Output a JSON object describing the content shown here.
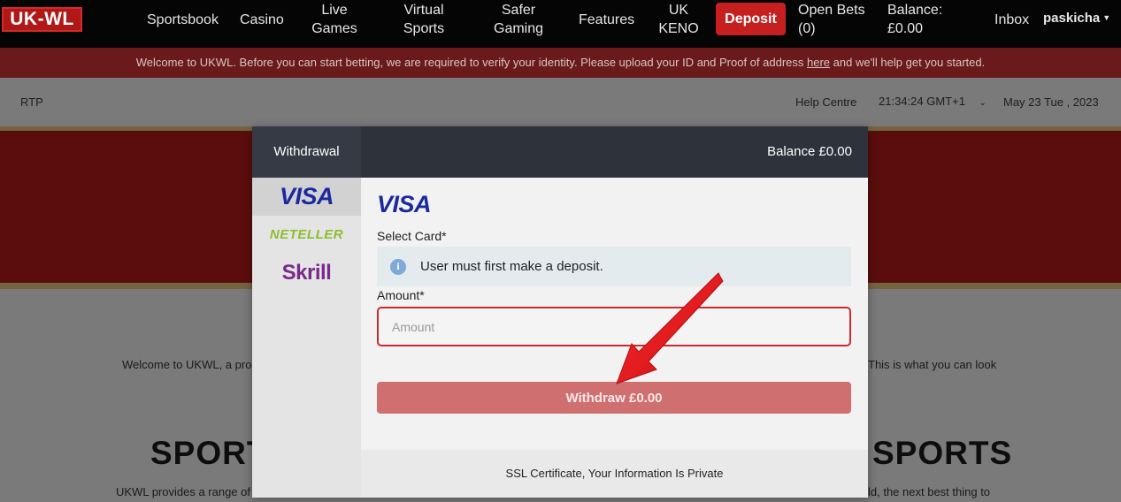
{
  "logo": {
    "text": "UK-WL"
  },
  "nav": {
    "sportsbook": "Sportsbook",
    "casino": "Casino",
    "live_games": [
      "Live",
      "Games"
    ],
    "virtual_sports": [
      "Virtual",
      "Sports"
    ],
    "safer_gaming": [
      "Safer",
      "Gaming"
    ],
    "features": "Features",
    "uk_keno": [
      "UK",
      "KENO"
    ],
    "deposit": "Deposit",
    "open_bets": [
      "Open Bets",
      "(0)"
    ],
    "balance": [
      "Balance:",
      "£0.00"
    ],
    "inbox": "Inbox",
    "user": "paskicha"
  },
  "banner": {
    "before": "Welcome to UKWL. Before you can start betting, we are required to verify your identity. Please upload your ID and Proof of address ",
    "link": "here",
    "after": " and we'll help get you started."
  },
  "subheader": {
    "rtp": "RTP",
    "help": "Help Centre",
    "time": "21:34:24 GMT+1",
    "date": "May 23 Tue , 2023"
  },
  "page": {
    "welcome_left": "Welcome to UKWL, a pro",
    "welcome_right": "This is what you can look",
    "head_left": "SPORT",
    "head_right": "SPORTS",
    "bottom_left": "UKWL provides a range of",
    "bottom_right": "ld, the next best thing to"
  },
  "modal": {
    "title": "Withdrawal",
    "balance": "Balance £0.00",
    "methods": [
      "VISA",
      "NETELLER",
      "Skrill"
    ],
    "selected_method": "VISA",
    "select_card_label": "Select Card*",
    "notice": "User must first make a deposit.",
    "amount_label": "Amount*",
    "amount_placeholder": "Amount",
    "withdraw_button": "Withdraw £0.00",
    "ssl_text": "SSL Certificate, Your Information Is Private"
  },
  "colors": {
    "nav_bg": "#050505",
    "deposit_red": "#c51f1f",
    "banner": "#6a1a1a",
    "modal_header": "#2e323b",
    "withdraw_button": "#cf6f6f",
    "annotation_arrow": "#e0141c"
  }
}
